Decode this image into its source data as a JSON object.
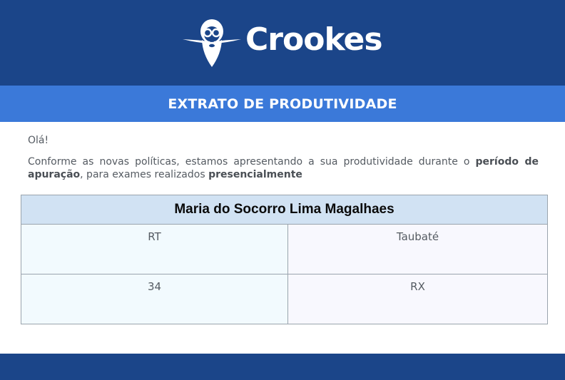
{
  "brand": {
    "name": "Crookes",
    "logo_icon": "scientist-face-icon",
    "colors": {
      "header": "#1b4589",
      "title_bar": "#3b79d9",
      "card_header": "#d1e2f3"
    }
  },
  "title_bar": {
    "title": "EXTRATO DE PRODUTIVIDADE"
  },
  "intro": {
    "greeting": "Olá!",
    "text_before": "Conforme as novas políticas, estamos apresentando a sua produtividade durante o ",
    "bold_period": "período de apuração",
    "text_middle": ", para exames realizados ",
    "bold_mode": "presencialmente"
  },
  "card": {
    "name": "Maria do Socorro Lima Magalhaes",
    "rows": [
      {
        "left": "RT",
        "right": "Taubaté"
      },
      {
        "left": "34",
        "right": "RX"
      }
    ]
  }
}
